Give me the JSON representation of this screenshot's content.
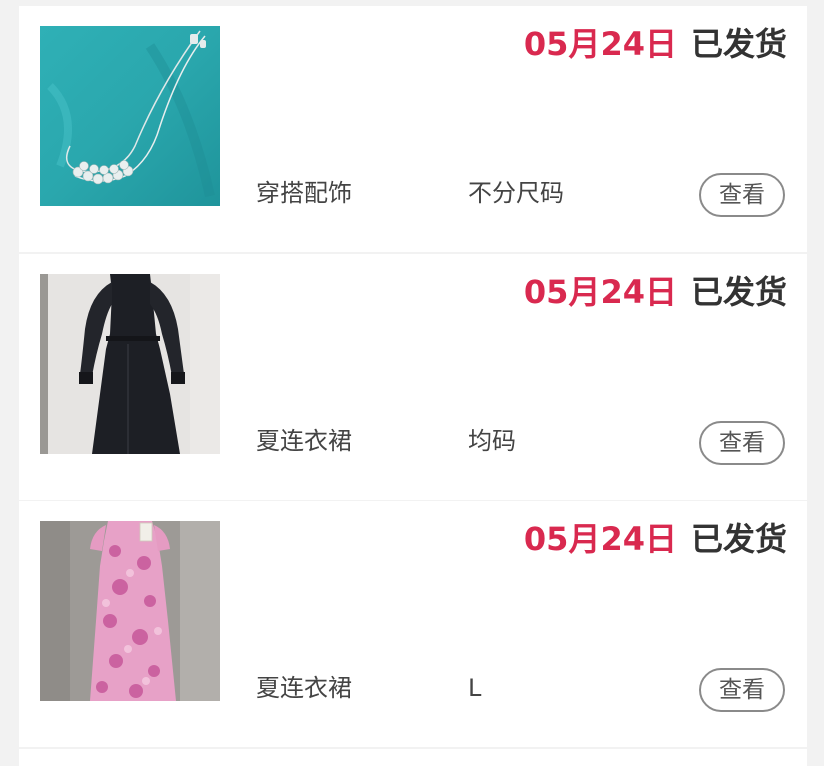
{
  "orders": [
    {
      "date": "05月24日",
      "status": "已发货",
      "category": "穿搭配饰",
      "size": "不分尺码",
      "view_label": "查看",
      "thumb_desc": "necklace-photo"
    },
    {
      "date": "05月24日",
      "status": "已发货",
      "category": "夏连衣裙",
      "size": "均码",
      "view_label": "查看",
      "thumb_desc": "black-dress-photo"
    },
    {
      "date": "05月24日",
      "status": "已发货",
      "category": "夏连衣裙",
      "size": "L",
      "view_label": "查看",
      "thumb_desc": "pink-floral-dress-photo"
    }
  ],
  "colors": {
    "date_accent": "#d9294f",
    "status_text": "#333333",
    "background": "#f2f2f2",
    "card": "#ffffff",
    "button_border": "#8a8a8a"
  }
}
